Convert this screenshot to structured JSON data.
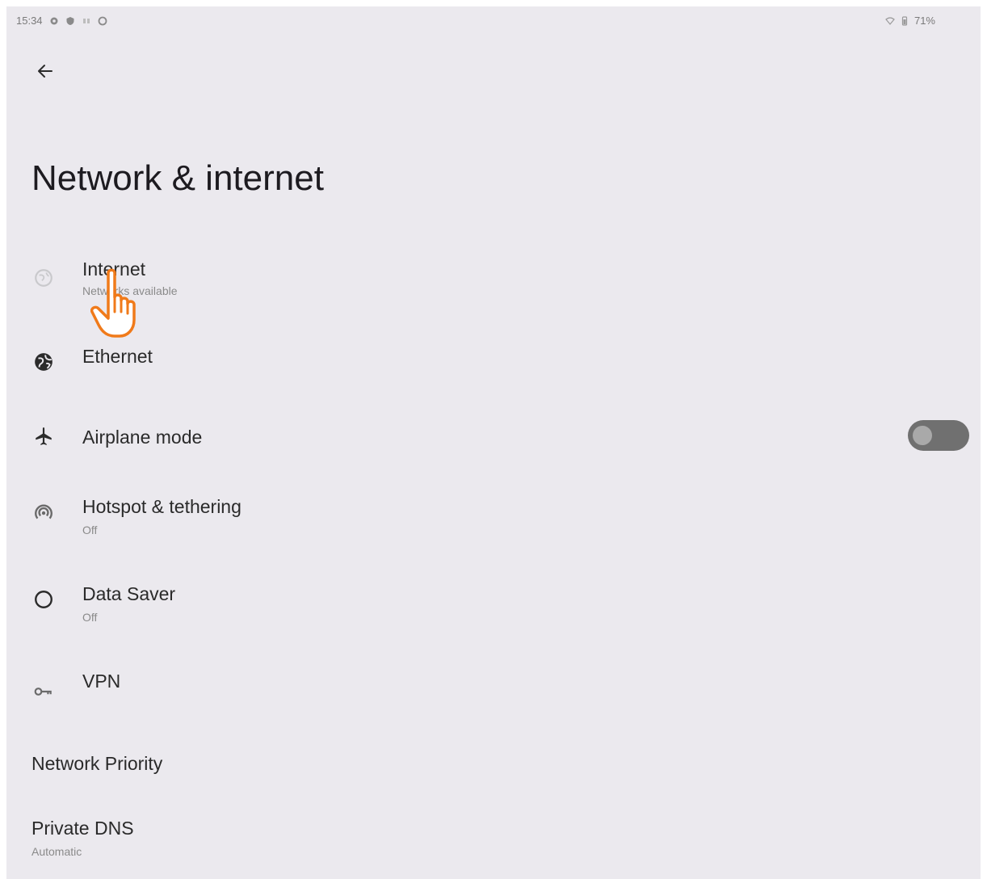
{
  "status_bar": {
    "time": "15:34",
    "battery": "71%"
  },
  "header": {
    "title": "Network & internet"
  },
  "items": [
    {
      "title": "Internet",
      "subtitle": "Networks available",
      "icon": "globe-icon"
    },
    {
      "title": "Ethernet",
      "icon": "ethernet-globe-icon"
    },
    {
      "title": "Airplane mode",
      "icon": "airplane-icon",
      "toggle": "off"
    },
    {
      "title": "Hotspot & tethering",
      "subtitle": "Off",
      "icon": "hotspot-icon"
    },
    {
      "title": "Data Saver",
      "subtitle": "Off",
      "icon": "data-saver-icon"
    },
    {
      "title": "VPN",
      "icon": "vpn-key-icon"
    },
    {
      "title": "Network Priority"
    },
    {
      "title": "Private DNS",
      "subtitle": "Automatic"
    }
  ],
  "colors": {
    "background": "#ebe9ee",
    "toggle_track": "#707070",
    "cursor_accent": "#f07a1a"
  }
}
